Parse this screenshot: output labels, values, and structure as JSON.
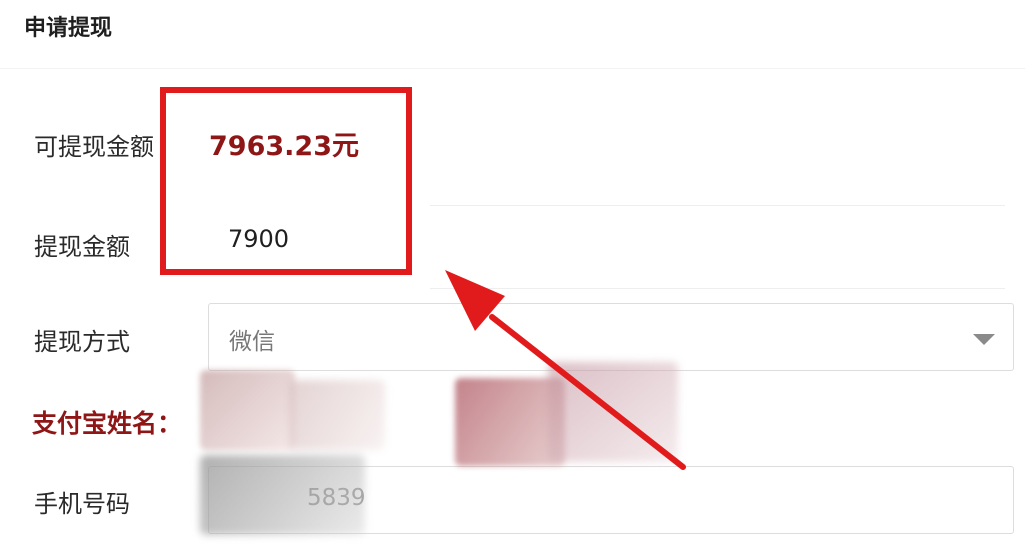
{
  "page": {
    "title": "申请提现"
  },
  "form": {
    "available_amount": {
      "label": "可提现金额",
      "value": "7963.23元"
    },
    "withdraw_amount": {
      "label": "提现金额",
      "value": "7900"
    },
    "withdraw_method": {
      "label": "提现方式",
      "value": "微信"
    },
    "alipay_name": {
      "label": "支付宝姓名：",
      "value": ""
    },
    "phone_number": {
      "label": "手机号码",
      "value": "5839"
    }
  },
  "annotation": {
    "highlight_color": "#e11b1b",
    "arrow_color": "#e11b1b"
  },
  "colors": {
    "amount_text": "#8e1616",
    "label_text": "#2a2a2a",
    "border": "#dddddd"
  },
  "icons": {
    "select_chevron": "chevron-down-icon",
    "annotation_arrow": "arrow-up-left-icon"
  }
}
